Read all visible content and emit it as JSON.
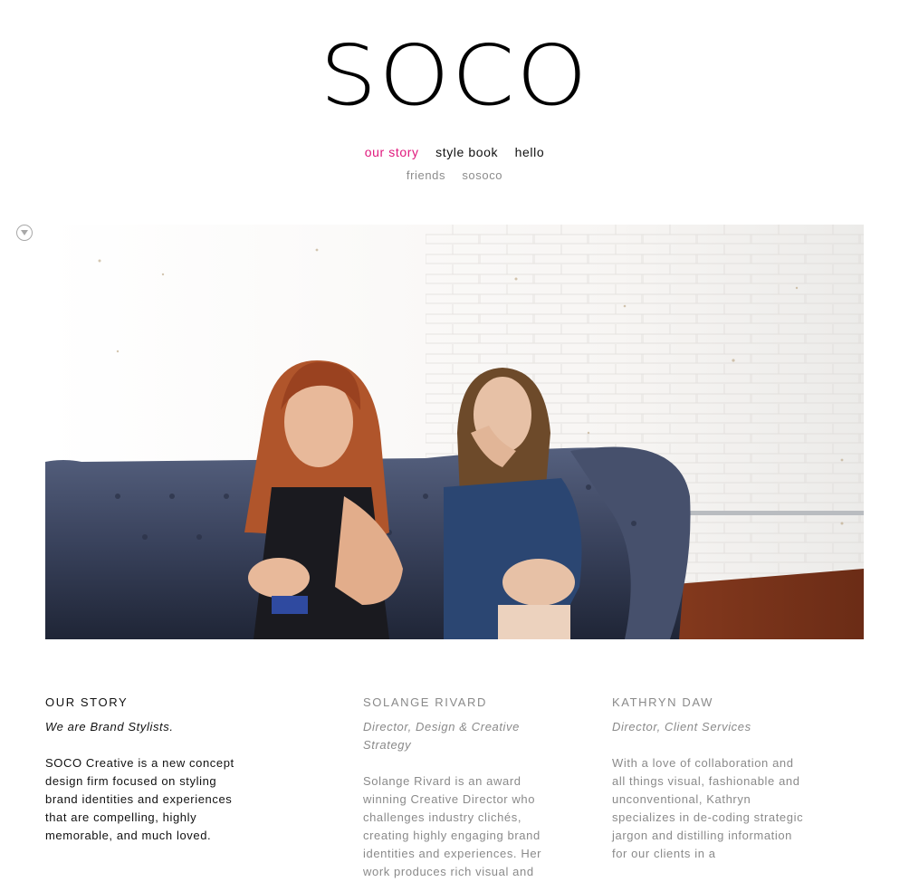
{
  "logo": "SOCO",
  "nav": {
    "primary": [
      {
        "label": "our story",
        "active": true
      },
      {
        "label": "style book",
        "active": false
      },
      {
        "label": "hello",
        "active": false
      }
    ],
    "secondary": [
      {
        "label": "friends"
      },
      {
        "label": "sosoco"
      }
    ],
    "active_color": "#e0197d"
  },
  "hero_image": {
    "description_icon": "photo",
    "scroll_toggle_icon": "chevron-down-circle-icon"
  },
  "columns": [
    {
      "heading": "OUR STORY",
      "subtitle": "We are Brand Stylists.",
      "body": "SOCO Creative is a new concept design firm focused on styling brand identities and experiences that are compelling, highly memorable, and much loved."
    },
    {
      "heading": "SOLANGE RIVARD",
      "subtitle": "Director, Design & Creative Strategy",
      "body": "Solange Rivard is an award winning Creative Director who challenges industry clichés, creating highly engaging brand identities and experiences. Her work produces rich visual and"
    },
    {
      "heading": "KATHRYN DAW",
      "subtitle": "Director, Client Services",
      "body": "With a love of collaboration and all things visual, fashionable and unconventional, Kathryn specializes in de-coding strategic jargon and distilling information for our clients in a"
    }
  ]
}
